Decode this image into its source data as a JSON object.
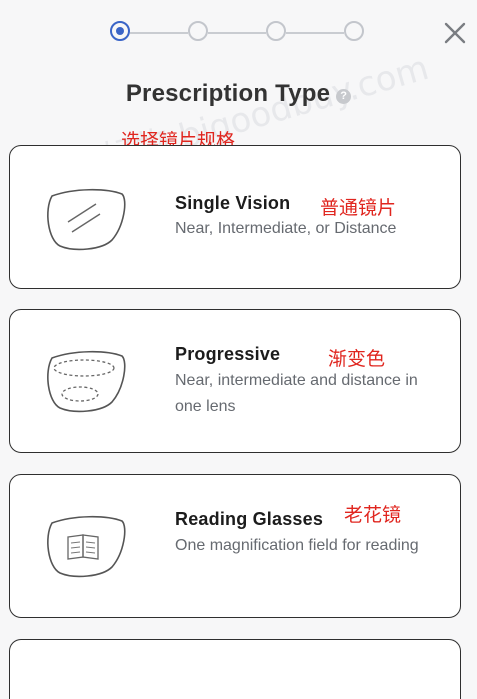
{
  "stepper": {
    "total_steps": 4,
    "current_step": 1
  },
  "header": {
    "title": "Prescription Type",
    "help_symbol": "?",
    "title_annotation": "选择镜片规格",
    "close_icon": "close-icon"
  },
  "watermark": {
    "text": "乐享好物 bigoodbuy.com"
  },
  "options": [
    {
      "title": "Single Vision",
      "description": "Near, Intermediate, or Distance",
      "annotation": "普通镜片",
      "icon": "single-vision-lens-icon"
    },
    {
      "title": "Progressive",
      "description": "Near, intermediate and distance in one lens",
      "annotation": "渐变色",
      "icon": "progressive-lens-icon"
    },
    {
      "title": "Reading Glasses",
      "description": "One magnification field for reading",
      "annotation": "老花镜",
      "icon": "reading-lens-icon"
    }
  ],
  "colors": {
    "accent": "#3a64c7",
    "annotation_red": "#e0261f",
    "border": "#2f2f2f",
    "background": "#f7f7f8"
  }
}
